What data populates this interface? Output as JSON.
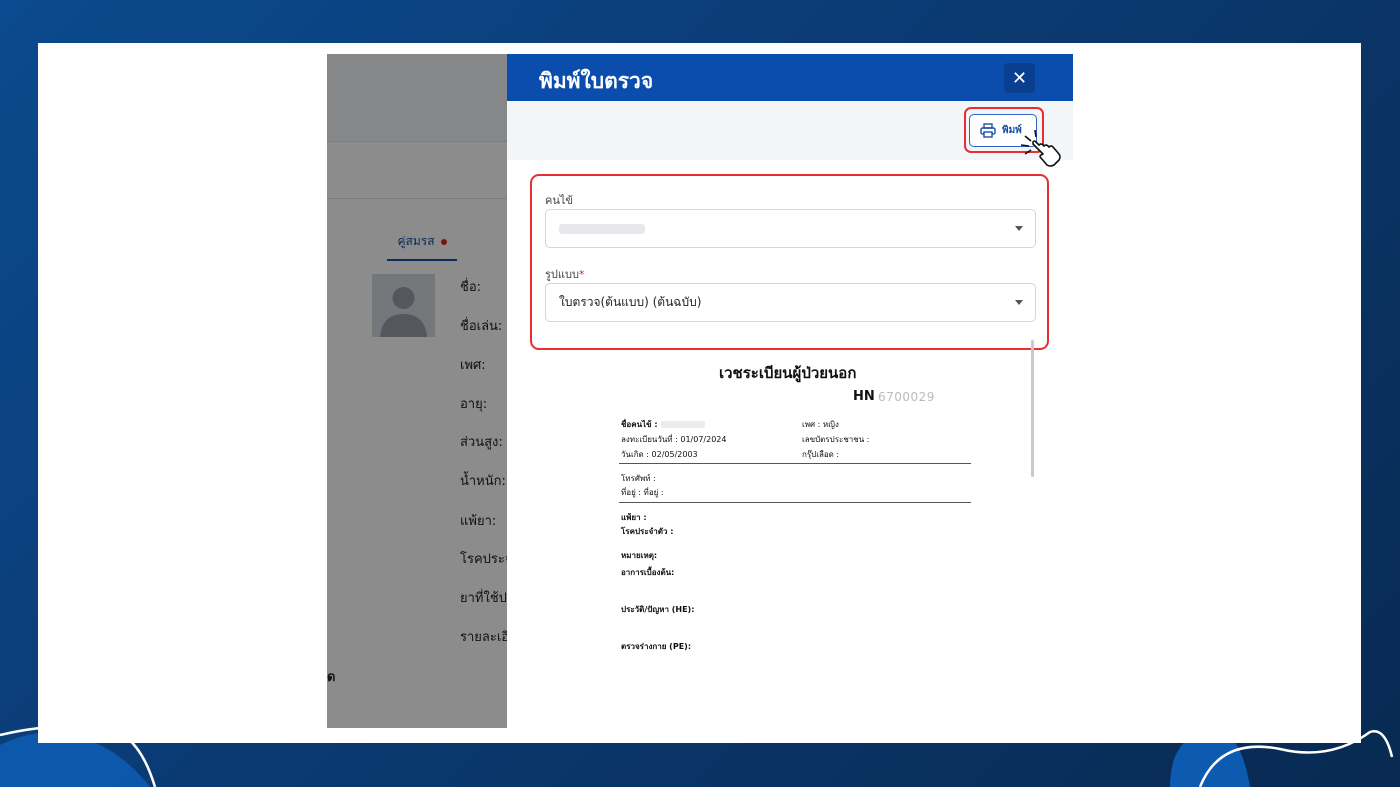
{
  "modal": {
    "title": "พิมพ์ใบตรวจ",
    "close_label": "✕",
    "print_label": "พิมพ์",
    "patient_label": "คนไข้",
    "format_label": "รูปแบบ",
    "format_required": "*",
    "format_value": "ใบตรวจ(ต้นแบบ) (ต้นฉบับ)"
  },
  "background": {
    "tab_label": "คู่สมรส",
    "fields": [
      "ชื่อ:",
      "ชื่อเล่น:",
      "เพศ:",
      "อายุ:",
      "ส่วนสูง:",
      "น้ำหนัก:",
      "แพ้ยา:",
      "โรคประจ",
      "ยาที่ใช้ป",
      "รายละเอี"
    ],
    "bottom_label": "ด"
  },
  "document": {
    "title": "เวชระเบียนผู้ป่วยนอก",
    "hn_label": "HN",
    "hn_value": "6700029",
    "patient_name_label": "ชื่อคนไข้ :",
    "register_date": "ลงทะเบียนวันที่ : 01/07/2024",
    "birth_date": "วันเกิด : 02/05/2003",
    "gender": "เพศ : หญิง",
    "citizen_id": "เลขบัตรประชาชน :",
    "blood_group": "กรุ๊ปเลือด :",
    "phone": "โทรศัพท์ :",
    "address": "ที่อยู่ : ที่อยู่ :",
    "allergy": "แพ้ยา :",
    "chronic": "โรคประจำตัว :",
    "note": "หมายเหตุ:",
    "symptom": "อาการเบื้องต้น:",
    "history": "ประวัติ/ปัญหา (HE):",
    "exam": "ตรวจร่างกาย (PE):"
  },
  "colors": {
    "modal_header": "#0a4dad",
    "highlight": "#e53030",
    "accent": "#1a4fa8"
  }
}
